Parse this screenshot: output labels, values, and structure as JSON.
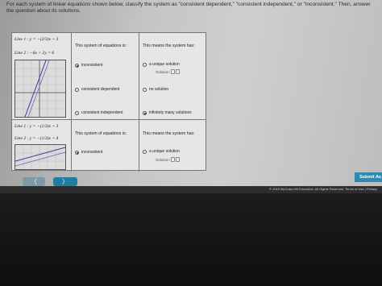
{
  "instructions": "For each system of linear equations shown below, classify the system as \"consistent dependent,\" \"consistent independent,\" or \"inconsistent.\" Then, answer the question about its solutions.",
  "problems": [
    {
      "line1": "Line 1 : y = −(2/3)x + 3",
      "line2": "Line 2 : −6x + 2y = 6",
      "system_header": "This system of equations is:",
      "meaning_header": "This means the system has:",
      "system_options": [
        "inconsistent",
        "consistent dependent",
        "consistent independent"
      ],
      "system_selected": "inconsistent",
      "meaning_options": [
        "a unique solution",
        "no solution",
        "infinitely many solutions"
      ],
      "meaning_selected": "infinitely many solutions",
      "solution_label": "Solution:"
    },
    {
      "line1": "Line 1 : y = −(1/3)x + 3",
      "line2": "Line 2 : y = −(1/3)x + 4",
      "system_header": "This system of equations is:",
      "meaning_header": "This means the system has:",
      "system_options": [
        "inconsistent"
      ],
      "system_selected": "inconsistent",
      "meaning_options": [
        "a unique solution"
      ],
      "meaning_selected": "",
      "solution_label": "Solution:"
    }
  ],
  "nav": {
    "prev_label": "〈",
    "next_label": "〉",
    "submit_label": "Submit As"
  },
  "footer": "© 2019 McGraw-Hill Education. All Rights Reserved.   Terms of Use  |  Privacy",
  "colors": {
    "next_button": "#1e7ea0",
    "submit_button": "#2f8ab0",
    "graph_line1": "#3a3aa0",
    "graph_line2": "#7a7ad0"
  }
}
